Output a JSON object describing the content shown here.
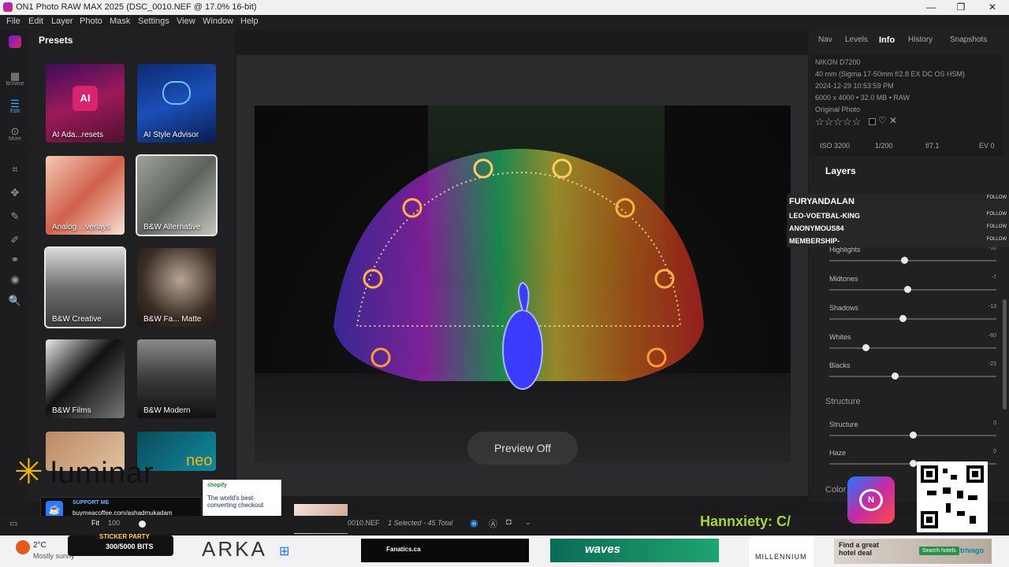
{
  "window": {
    "title": "ON1 Photo RAW MAX 2025 (DSC_0010.NEF @ 17.0% 16-bit)",
    "minimize": "—",
    "maximize": "❐",
    "close": "✕"
  },
  "menu": [
    "File",
    "Edit",
    "Layer",
    "Photo",
    "Mask",
    "Settings",
    "View",
    "Window",
    "Help"
  ],
  "leftbar": {
    "browse": "Browse",
    "edit": "Edit",
    "more": "More"
  },
  "presets": {
    "title": "Presets",
    "tiles": [
      "AI Ada...resets",
      "AI Style Advisor",
      "Analog ...verlays",
      "B&W Alternative",
      "B&W Creative",
      "B&W Fa... Matte",
      "B&W Films",
      "B&W Modern"
    ],
    "ai_badge": "AI"
  },
  "preview_off": "Preview Off",
  "right_tabs": [
    "Nav",
    "Levels",
    "Info",
    "History",
    "Snapshots"
  ],
  "info": {
    "camera": "NIKON D7200",
    "lens": "40 mm (Sigma 17-50mm f/2.8 EX DC OS HSM)",
    "date": "2024-12-29 10:53:59 PM",
    "size": "6000 x 4000 • 32.0 MB • RAW",
    "kind": "Original Photo",
    "stars": "☆☆☆☆☆",
    "iso": "ISO 3200",
    "shutter": "1/200",
    "aperture": "f/7.1",
    "ev": "EV 0"
  },
  "layers": {
    "title": "Layers"
  },
  "sliders": [
    {
      "name": "Highlights",
      "value": "-10",
      "pos": 0.45
    },
    {
      "name": "Midtones",
      "value": "-7",
      "pos": 0.47
    },
    {
      "name": "Shadows",
      "value": "-13",
      "pos": 0.44
    },
    {
      "name": "Whites",
      "value": "-60",
      "pos": 0.22
    },
    {
      "name": "Blacks",
      "value": "-23",
      "pos": 0.39
    }
  ],
  "structure": {
    "title": "Structure",
    "sliders": [
      {
        "name": "Structure",
        "value": "0",
        "pos": 0.5
      },
      {
        "name": "Haze",
        "value": "0",
        "pos": 0.5
      }
    ]
  },
  "color_section": "Color",
  "chat": [
    {
      "user": "FURYANDALAN",
      "btn": "FOLLOW"
    },
    {
      "user": "LEO-VOETBAL-KING",
      "btn": "FOLLOW"
    },
    {
      "user": "ANONYMOUS84",
      "btn": "FOLLOW"
    },
    {
      "user": "MEMBERSHIP-",
      "btn": "FOLLOW"
    }
  ],
  "bottombar": {
    "fit": "Fit",
    "zoom": "100",
    "file": "0010.NEF",
    "selected": "1 Selected - 45 Total"
  },
  "overlays": {
    "luminar": "luminar",
    "neo": "neo",
    "support_title": "SUPPORT ME",
    "support_url": "buymeacoffee.com/ashadmukadam",
    "shopify_brand": "shopify",
    "shopify_text": "The world's best-converting checkout",
    "hannxiety": "Hannxiety: C/",
    "sticker": "STICKER PARTY",
    "bits": "300/5000 BITS"
  },
  "taskbar": {
    "temp": "2°C",
    "weather": "Mostly sunny",
    "arka": "ARKA",
    "fanatics": "Fanatics.ca",
    "waves": "waves",
    "millennium": "MILLENNIUM",
    "hotel": "Find a great hotel deal",
    "search_hotels": "Search hotels",
    "trivago": "trivago"
  }
}
